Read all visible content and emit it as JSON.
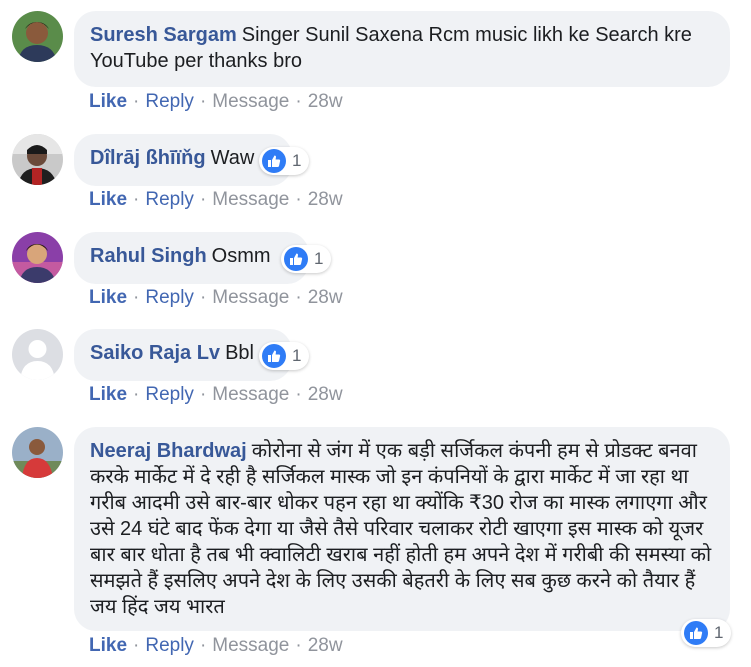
{
  "comments": [
    {
      "name": "Suresh Sargam",
      "text": "Singer Sunil Saxena Rcm music likh ke Search kre YouTube per thanks bro",
      "actions": {
        "like": "Like",
        "reply": "Reply",
        "message": "Message",
        "time": "28w"
      },
      "reactions": null
    },
    {
      "name": "Dîlrāj ßhīïňg",
      "text": "Waw",
      "actions": {
        "like": "Like",
        "reply": "Reply",
        "message": "Message",
        "time": "28w"
      },
      "reactions": "1"
    },
    {
      "name": "Rahul Singh",
      "text": "Osmm",
      "actions": {
        "like": "Like",
        "reply": "Reply",
        "message": "Message",
        "time": "28w"
      },
      "reactions": "1"
    },
    {
      "name": "Saiko Raja Lv",
      "text": "Bbl",
      "actions": {
        "like": "Like",
        "reply": "Reply",
        "message": "Message",
        "time": "28w"
      },
      "reactions": "1"
    },
    {
      "name": "Neeraj Bhardwaj",
      "text": "कोरोना से जंग में एक बड़ी सर्जिकल कंपनी हम से प्रोडक्ट बनवा करके मार्केट में दे रही है सर्जिकल मास्क जो इन कंपनियों के द्वारा मार्केट में जा रहा था गरीब आदमी उसे बार-बार धोकर पहन रहा था क्योंकि ₹30 रोज का मास्क लगाएगा और उसे 24 घंटे बाद फेंक देगा या जैसे तैसे परिवार चलाकर रोटी खाएगा इस मास्क को यूजर बार बार धोता है तब भी क्वालिटी खराब नहीं होती हम अपने देश में गरीबी की समस्या को समझते हैं इसलिए अपने देश के लिए उसकी बेहतरी के लिए सब कुछ करने को तैयार हैं जय हिंद जय भारत",
      "actions": {
        "like": "Like",
        "reply": "Reply",
        "message": "Message",
        "time": "28w"
      },
      "reactions": "1"
    }
  ],
  "colors": {
    "name": "#385898",
    "bubble": "#f0f2f5",
    "like": "#4267b2",
    "meta": "#90949c",
    "badge": "#2f7cf6"
  },
  "icons": {
    "reaction": "thumbs-up-icon",
    "separator": "·"
  }
}
